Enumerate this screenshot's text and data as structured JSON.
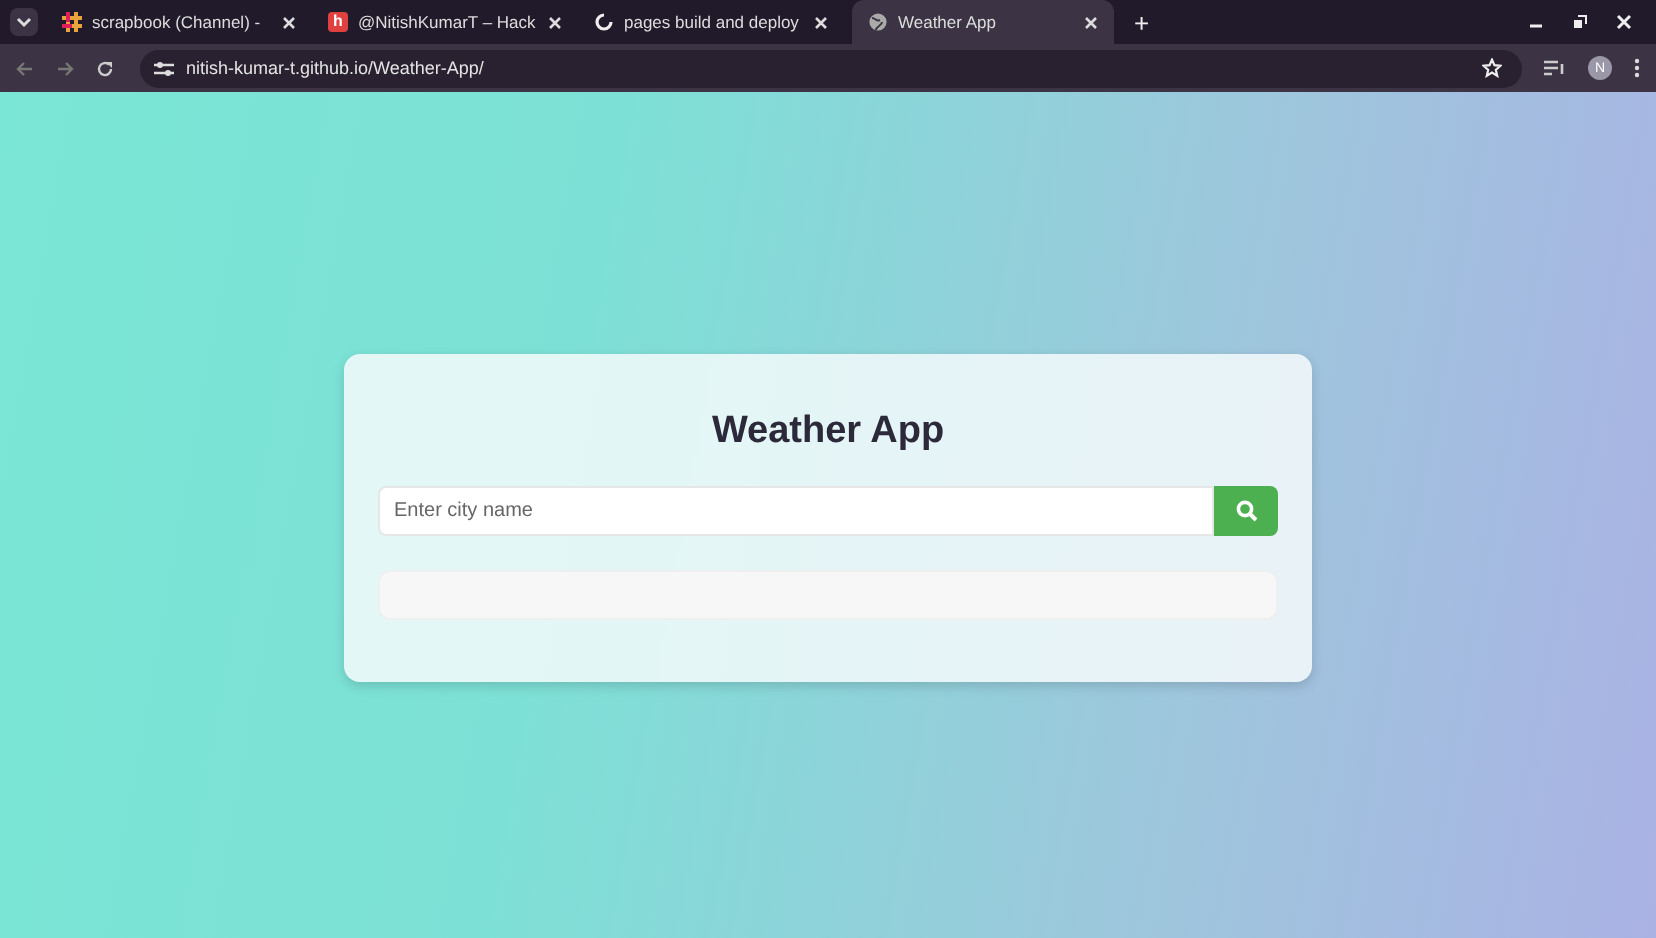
{
  "browser": {
    "tabs": [
      {
        "title": "scrapbook (Channel) -",
        "selected": false
      },
      {
        "title": "@NitishKumarT – Hack",
        "icon_text": "h",
        "selected": false
      },
      {
        "title": "pages build and deploy",
        "selected": false
      },
      {
        "title": "Weather App",
        "selected": true
      }
    ],
    "new_tab": "+",
    "url": "nitish-kumar-t.github.io/Weather-App/",
    "profile": "N"
  },
  "app": {
    "title": "Weather App",
    "search": {
      "placeholder": "Enter city name"
    }
  }
}
